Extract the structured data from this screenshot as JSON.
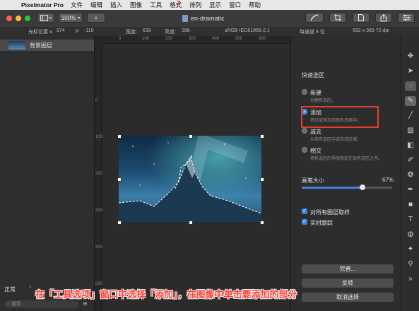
{
  "menubar": {
    "apple": "",
    "app_name": "Pixelmator Pro",
    "items": [
      "文件",
      "编辑",
      "插入",
      "图像",
      "工具",
      "格式",
      "排列",
      "显示",
      "窗口",
      "帮助"
    ],
    "watermark": "Z"
  },
  "toolbar": {
    "zoom": "100%",
    "add": "+",
    "doc_title": "en-dramatic",
    "colors": {
      "close": "#ff5f57",
      "minimize": "#febc2e",
      "zoom": "#28c840"
    }
  },
  "infobar": {
    "cursor_label": "光标位置 x:",
    "cursor_x": "974",
    "cursor_y_label": "y:",
    "cursor_y": "-110",
    "width_label": "宽度:",
    "width": "639",
    "height_label": "高度:",
    "height": "288",
    "color_profile": "sRGB IEC61966-2.1",
    "channel_depth": "每通道 8 位",
    "size": "692 x 389 72 dpi"
  },
  "layers": {
    "items": [
      {
        "name": "背景图层"
      }
    ],
    "blend_mode": "正常",
    "search_placeholder": "搜索"
  },
  "ruler": {
    "top": [
      "0",
      "100",
      "200",
      "300",
      "400",
      "500",
      "600"
    ],
    "left": [
      "0",
      "100",
      "200",
      "300",
      "400",
      "500"
    ]
  },
  "options": {
    "title": "快速选区",
    "modes": [
      {
        "label": "新建",
        "desc": "创建新选区。",
        "selected": false
      },
      {
        "label": "添加",
        "desc": "将区域添加到现有选择中。",
        "selected": true
      },
      {
        "label": "减去",
        "desc": "从现有选区中减去选区域。",
        "selected": false
      },
      {
        "label": "相交",
        "desc": "将新选区的界限限定在现有选区之内。",
        "selected": false
      }
    ],
    "brush_size_label": "画笔大小",
    "brush_size_value": "67%",
    "brush_size_fraction": 0.67,
    "sample_all_layers": "对所有图层取样",
    "realtime_tracking": "实时跟踪",
    "buttons": [
      "完善...",
      "反转",
      "取消选择"
    ]
  },
  "tools": [
    "arrange-icon",
    "move-icon",
    "selection-icon",
    "quick-selection-icon",
    "paint-icon",
    "gradient-icon",
    "erase-icon",
    "retouch-icon",
    "effects-icon",
    "pen-icon",
    "shape-icon",
    "type-icon",
    "color-adjust-icon",
    "sparkle-icon",
    "zoom-icon",
    "more-icon"
  ],
  "caption": "在「工具选项」窗口中选择「添加」，在图像中单击要添加的部分"
}
